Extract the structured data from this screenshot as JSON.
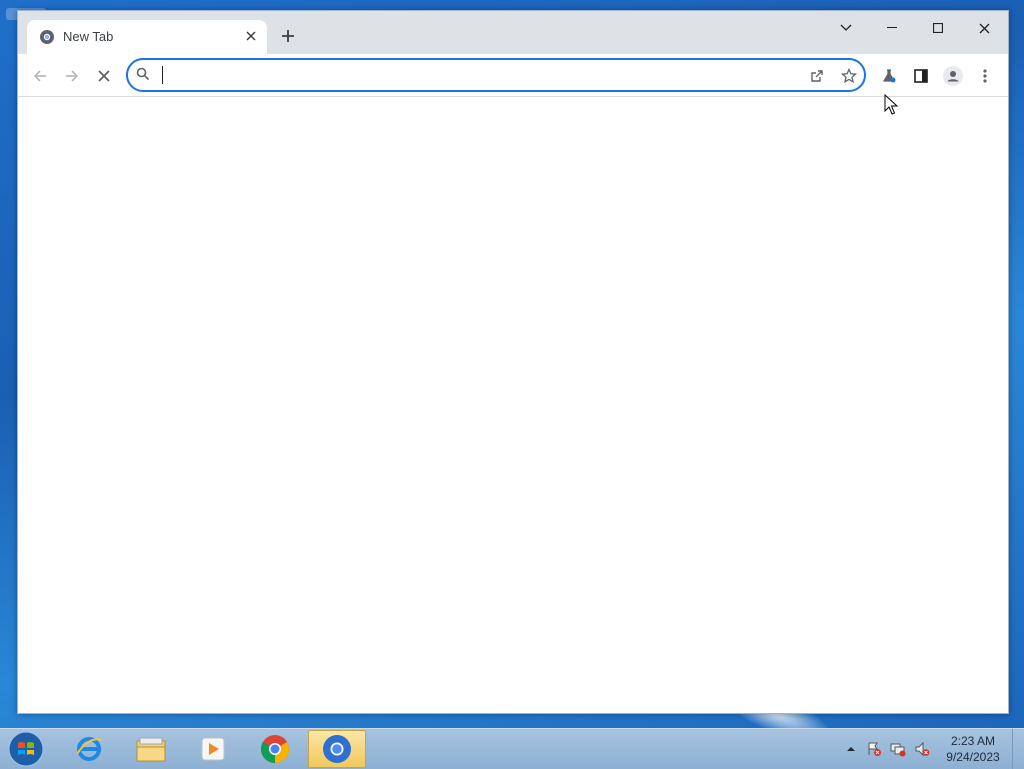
{
  "browser": {
    "tab": {
      "title": "New Tab"
    },
    "omnibox": {
      "value": "",
      "placeholder": ""
    }
  },
  "taskbar": {
    "clock": {
      "time": "2:23 AM",
      "date": "9/24/2023"
    }
  },
  "colors": {
    "accent": "#1a73e8",
    "titlebar": "#dee1e6",
    "icon": "#5f6368"
  }
}
